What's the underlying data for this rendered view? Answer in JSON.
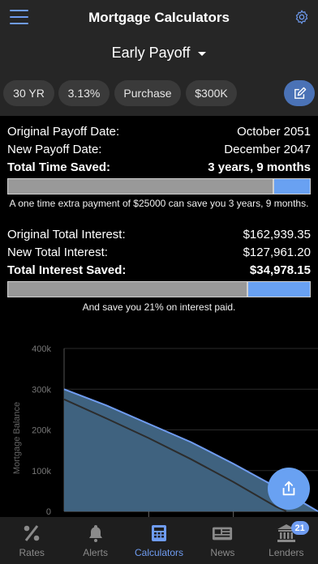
{
  "header": {
    "title": "Mortgage Calculators"
  },
  "calculator_select": {
    "label": "Early Payoff"
  },
  "chips": [
    {
      "label": "30 YR"
    },
    {
      "label": "3.13%"
    },
    {
      "label": "Purchase"
    },
    {
      "label": "$300K"
    }
  ],
  "payoff": {
    "original_label": "Original Payoff Date:",
    "original_value": "October 2051",
    "new_label": "New Payoff Date:",
    "new_value": "December 2047",
    "saved_label": "Total Time Saved:",
    "saved_value": "3 years, 9 months",
    "bar_fraction_saved": 0.125,
    "note": "A one time extra payment of $25000 can save you 3 years, 9 months."
  },
  "interest": {
    "original_label": "Original Total Interest:",
    "original_value": "$162,939.35",
    "new_label": "New Total Interest:",
    "new_value": "$127,961.20",
    "saved_label": "Total Interest Saved:",
    "saved_value": "$34,978.15",
    "bar_fraction_saved": 0.21,
    "note": "And save you 21% on interest paid."
  },
  "chart_data": {
    "type": "area",
    "ylabel": "Mortgage Balance",
    "y_ticks": [
      "400k",
      "300k",
      "200k",
      "100k",
      "0"
    ],
    "ylim": [
      0,
      400000
    ],
    "x_range_years": [
      0,
      30
    ],
    "grid": true,
    "series": [
      {
        "x": [
          0,
          5,
          10,
          15,
          20,
          25,
          30
        ],
        "y": [
          300000,
          260000,
          215000,
          170000,
          117000,
          60000,
          0
        ]
      },
      {
        "x": [
          0,
          5,
          10,
          15,
          20,
          25,
          26.25
        ],
        "y": [
          275000,
          228000,
          180000,
          128000,
          72000,
          12000,
          0
        ]
      }
    ],
    "colors": {
      "original_fill": "#3f627f",
      "original_line": "#6f9cf1",
      "new_line": "#2c2c2c"
    }
  },
  "tabs": [
    {
      "label": "Rates",
      "icon": "percent-icon"
    },
    {
      "label": "Alerts",
      "icon": "bell-icon"
    },
    {
      "label": "Calculators",
      "icon": "calculator-icon"
    },
    {
      "label": "News",
      "icon": "newspaper-icon"
    },
    {
      "label": "Lenders",
      "icon": "bank-icon",
      "badge": "21"
    }
  ],
  "colors": {
    "accent": "#6f9cf1",
    "panel": "#262626",
    "bar_gray": "#999999"
  }
}
